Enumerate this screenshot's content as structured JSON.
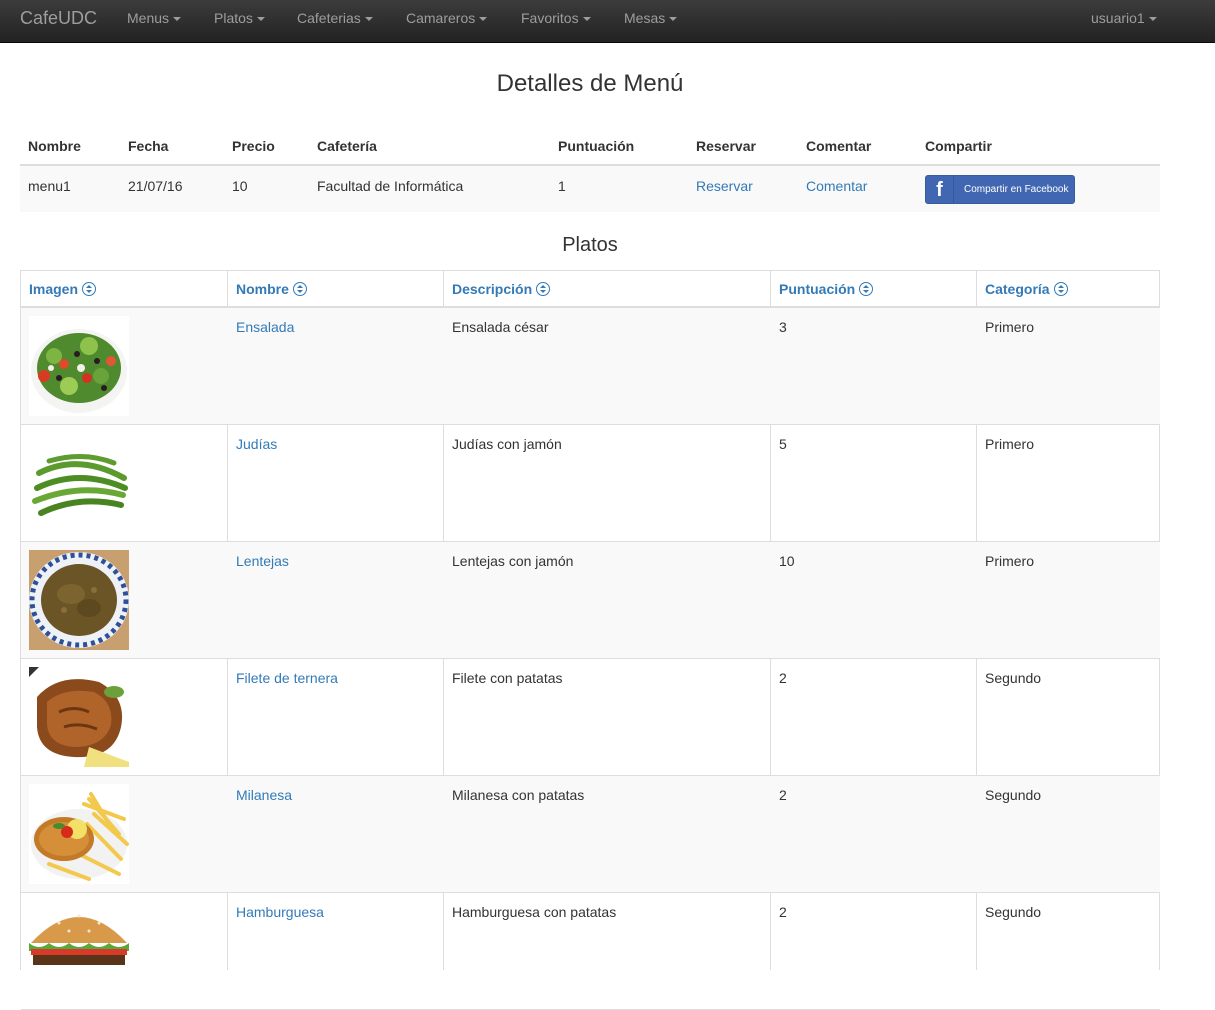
{
  "navbar": {
    "brand": "CafeUDC",
    "items": [
      {
        "label": "Menus"
      },
      {
        "label": "Platos"
      },
      {
        "label": "Cafeterias"
      },
      {
        "label": "Camareros"
      },
      {
        "label": "Favoritos"
      },
      {
        "label": "Mesas"
      }
    ],
    "user": "usuario1"
  },
  "page_title": "Detalles de Menú",
  "details": {
    "headers": [
      "Nombre",
      "Fecha",
      "Precio",
      "Cafetería",
      "Puntuación",
      "Reservar",
      "Comentar",
      "Compartir"
    ],
    "row": {
      "nombre": "menu1",
      "fecha": "21/07/16",
      "precio": "10",
      "cafeteria": "Facultad de Informática",
      "puntuacion": "1",
      "reservar": "Reservar",
      "comentar": "Comentar",
      "compartir": "Compartir en Facebook"
    }
  },
  "platos_title": "Platos",
  "platos": {
    "headers": [
      "Imagen",
      "Nombre",
      "Descripción",
      "Puntuación",
      "Categoría"
    ],
    "rows": [
      {
        "image": "ensalada-image",
        "nombre": "Ensalada",
        "descripcion": "Ensalada césar",
        "puntuacion": "3",
        "categoria": "Primero"
      },
      {
        "image": "judias-image",
        "nombre": "Judías",
        "descripcion": "Judías con jamón",
        "puntuacion": "5",
        "categoria": "Primero"
      },
      {
        "image": "lentejas-image",
        "nombre": "Lentejas",
        "descripcion": "Lentejas con jamón",
        "puntuacion": "10",
        "categoria": "Primero"
      },
      {
        "image": "filete-image",
        "nombre": "Filete de ternera",
        "descripcion": "Filete con patatas",
        "puntuacion": "2",
        "categoria": "Segundo"
      },
      {
        "image": "milanesa-image",
        "nombre": "Milanesa",
        "descripcion": "Milanesa con patatas",
        "puntuacion": "2",
        "categoria": "Segundo"
      },
      {
        "image": "hamburguesa-image",
        "nombre": "Hamburguesa",
        "descripcion": "Hamburguesa con patatas",
        "puntuacion": "2",
        "categoria": "Segundo"
      }
    ]
  }
}
